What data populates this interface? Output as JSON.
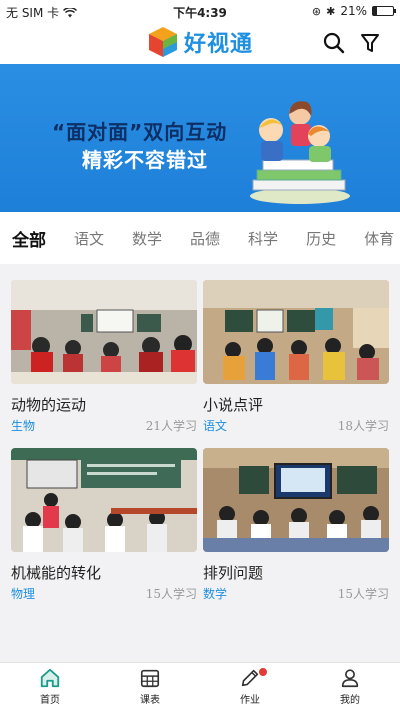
{
  "status_bar": {
    "carrier": "无 SIM 卡",
    "time": "下午4:39",
    "battery": "21%",
    "battery_level": 0.21
  },
  "header": {
    "logo_text": "好视通",
    "search_icon": "search-icon",
    "filter_icon": "filter-icon"
  },
  "banner": {
    "line1": "“面对面”双向互动",
    "line2": "精彩不容错过",
    "slide_count": 3,
    "active_slide": 0
  },
  "categories": [
    {
      "label": "全部",
      "active": true
    },
    {
      "label": "语文",
      "active": false
    },
    {
      "label": "数学",
      "active": false
    },
    {
      "label": "品德",
      "active": false
    },
    {
      "label": "科学",
      "active": false
    },
    {
      "label": "历史",
      "active": false
    },
    {
      "label": "体育",
      "active": false
    }
  ],
  "courses": [
    {
      "title": "动物的运动",
      "subject": "生物",
      "learners": "21人学习"
    },
    {
      "title": "小说点评",
      "subject": "语文",
      "learners": "18人学习"
    },
    {
      "title": "机械能的转化",
      "subject": "物理",
      "learners": "15人学习"
    },
    {
      "title": "排列问题",
      "subject": "数学",
      "learners": "15人学习"
    }
  ],
  "tabbar": [
    {
      "label": "首页",
      "icon": "home-icon",
      "active": true
    },
    {
      "label": "课表",
      "icon": "calendar-icon",
      "active": false
    },
    {
      "label": "作业",
      "icon": "pencil-icon",
      "active": false,
      "badge": true
    },
    {
      "label": "我的",
      "icon": "user-icon",
      "active": false
    }
  ],
  "colors": {
    "accent": "#1e8fe1",
    "banner": "#2a8fe3",
    "active_tab_icon": "#1a9a8a"
  }
}
